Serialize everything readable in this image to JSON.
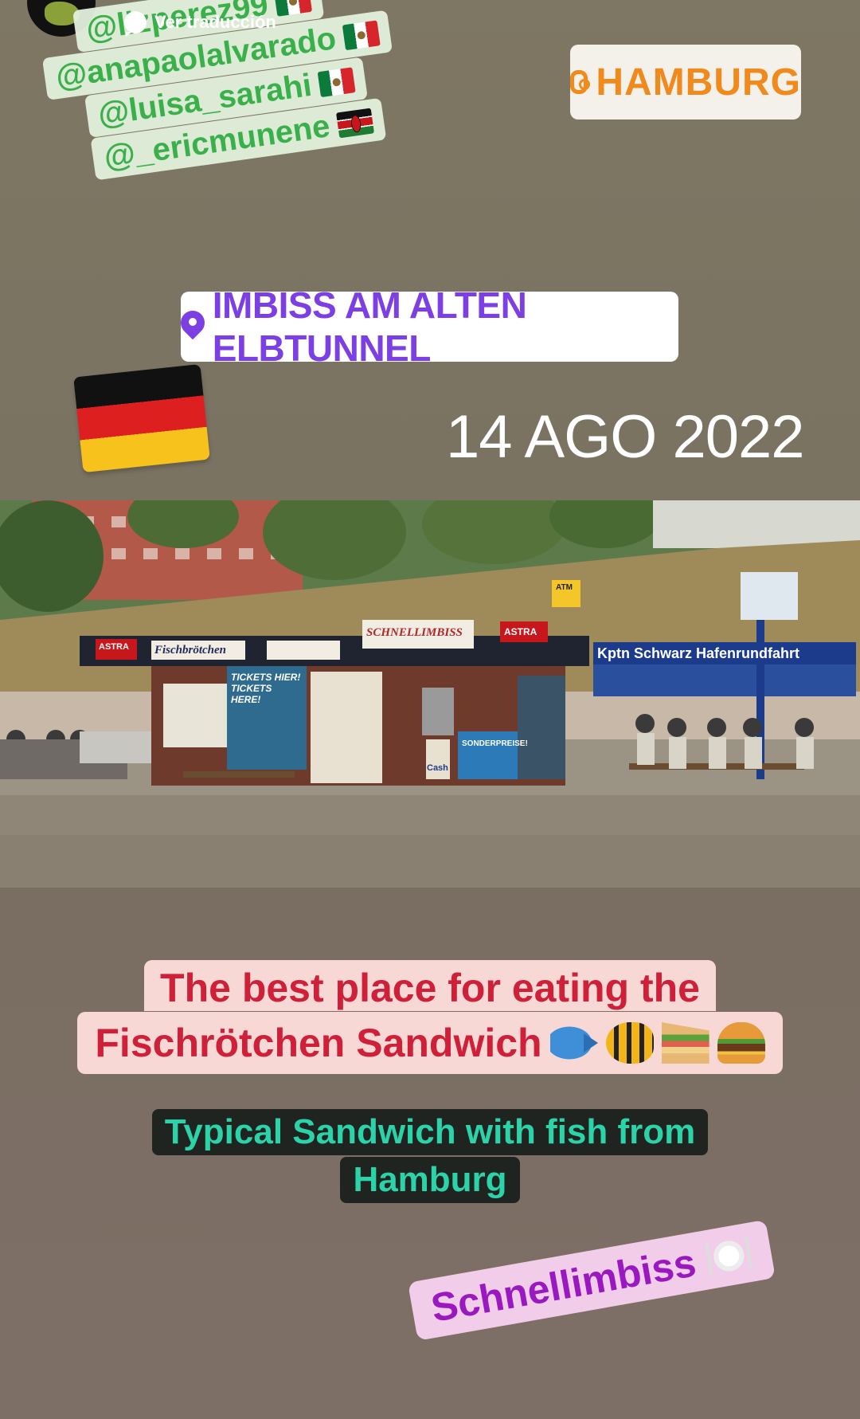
{
  "header": {
    "translate_label": "Ver traducción"
  },
  "mentions": [
    {
      "handle": "@lizperez99",
      "flag": "mx-flag-icon"
    },
    {
      "handle": "@anapaolalvarado",
      "flag": "mx-flag-icon"
    },
    {
      "handle": "@luisa_sarahi",
      "flag": "mx-flag-icon"
    },
    {
      "handle": "@_ericmunene",
      "flag": "ke-flag-icon"
    }
  ],
  "hashtag_sticker": {
    "text": "HAMBURG",
    "icon": "at-icon",
    "color": "#f08a1c"
  },
  "location_sticker": {
    "text": "IMBISS AM ALTEN ELBTUNNEL",
    "icon": "pin-icon",
    "color": "#7b3fe4"
  },
  "date": "14 AGO 2022",
  "photo": {
    "signs": {
      "astra_left": "ASTRA",
      "fischbrotchen": "Fischbrötchen",
      "schnellimbiss_sign": "SCHNELLIMBISS",
      "astra_right": "ASTRA",
      "atm": "ATM",
      "tickets": "TICKETS HIER! TICKETS HERE!",
      "banner": "Kptn Schwarz Hafenrundfahrt",
      "cash": "Cash",
      "sonderpreise": "SONDERPREISE!"
    }
  },
  "captions": {
    "line1": "The best place for eating the",
    "line2": "Fischrötchen Sandwich",
    "typical_line1": "Typical Sandwich with fish from",
    "typical_line2": "Hamburg",
    "schnellimbiss": "Schnellimbiss"
  }
}
